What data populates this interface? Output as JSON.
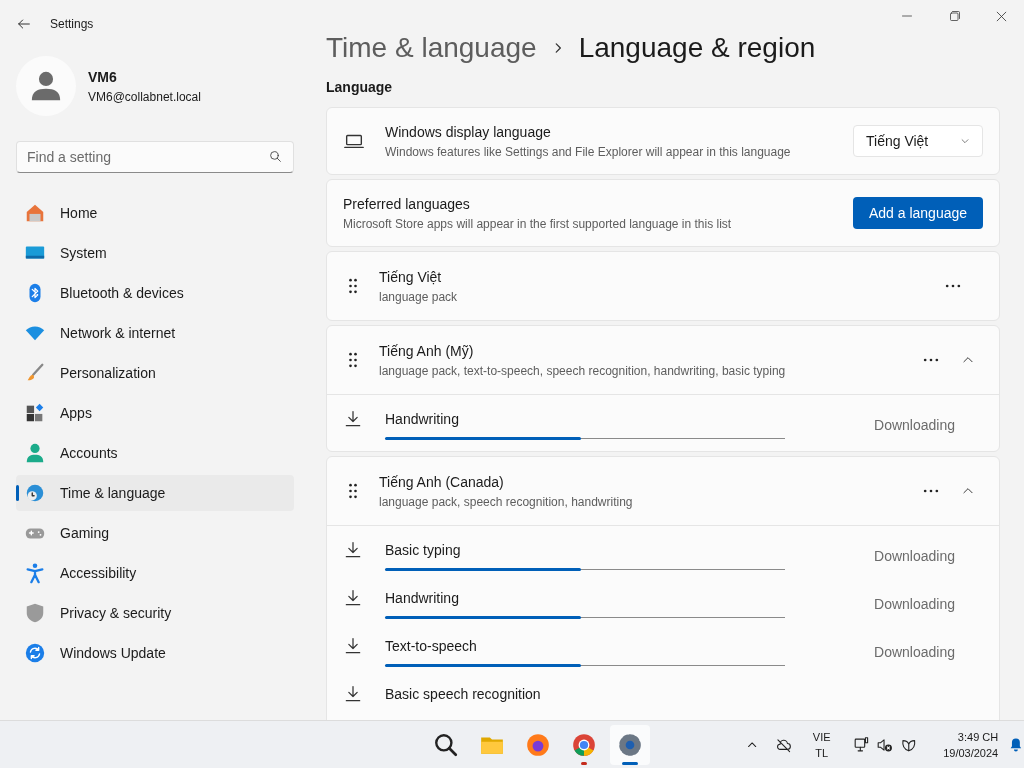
{
  "window": {
    "title": "Settings"
  },
  "account": {
    "name": "VM6",
    "email": "VM6@collabnet.local"
  },
  "search": {
    "placeholder": "Find a setting"
  },
  "sidebar": {
    "items": [
      {
        "label": "Home",
        "selected": false
      },
      {
        "label": "System",
        "selected": false
      },
      {
        "label": "Bluetooth & devices",
        "selected": false
      },
      {
        "label": "Network & internet",
        "selected": false
      },
      {
        "label": "Personalization",
        "selected": false
      },
      {
        "label": "Apps",
        "selected": false
      },
      {
        "label": "Accounts",
        "selected": false
      },
      {
        "label": "Time & language",
        "selected": true
      },
      {
        "label": "Gaming",
        "selected": false
      },
      {
        "label": "Accessibility",
        "selected": false
      },
      {
        "label": "Privacy & security",
        "selected": false
      },
      {
        "label": "Windows Update",
        "selected": false
      }
    ]
  },
  "breadcrumb": {
    "parent": "Time & language",
    "current": "Language & region"
  },
  "section": "Language",
  "display_language": {
    "title": "Windows display language",
    "description": "Windows features like Settings and File Explorer will appear in this language",
    "value": "Tiếng Việt"
  },
  "preferred": {
    "title": "Preferred languages",
    "description": "Microsoft Store apps will appear in the first supported language in this list",
    "button": "Add a language"
  },
  "languages": [
    {
      "name": "Tiếng Việt",
      "features": "language pack",
      "kind": "plain"
    },
    {
      "name": "Tiếng Anh (Mỹ)",
      "features": "language pack, text-to-speech, speech recognition, handwriting, basic typing",
      "kind": "expandable",
      "expanded": true,
      "downloads": [
        {
          "label": "Handwriting",
          "level": 0.49,
          "status": "Downloading"
        }
      ]
    },
    {
      "name": "Tiếng Anh (Canada)",
      "features": "language pack, speech recognition, handwriting",
      "kind": "expandable",
      "expanded": true,
      "downloads": [
        {
          "label": "Basic typing",
          "level": 0.49,
          "status": "Downloading"
        },
        {
          "label": "Handwriting",
          "level": 0.49,
          "status": "Downloading"
        },
        {
          "label": "Text-to-speech",
          "level": 0.49,
          "status": "Downloading"
        },
        {
          "label": "Basic speech recognition"
        }
      ]
    }
  ],
  "taskbar": {
    "apps": [
      {
        "running": false,
        "selected": false
      },
      {
        "running": false,
        "selected": false
      },
      {
        "running": false,
        "selected": false
      },
      {
        "running": true,
        "selected": false
      },
      {
        "running": true,
        "selected": true
      }
    ],
    "language": [
      "VIE",
      "TL"
    ],
    "time": "3:49 CH",
    "date": "19/03/2024"
  }
}
